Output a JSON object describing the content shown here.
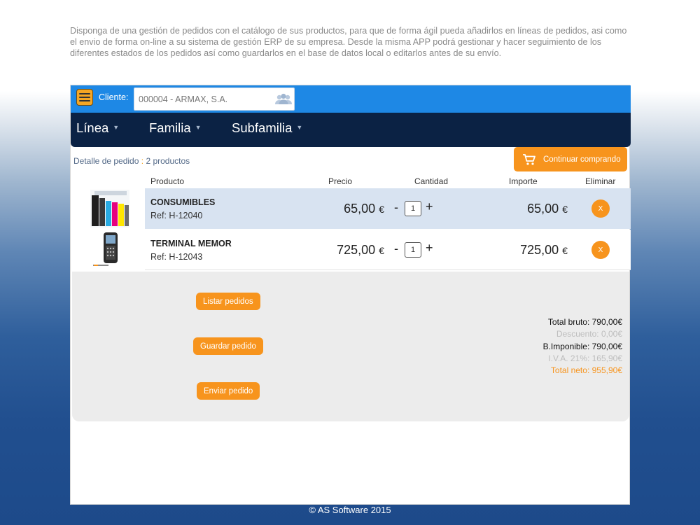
{
  "intro_text": "Disponga de una gestión de pedidos con el catálogo de sus productos, para que de  forma ágil pueda añadirlos en líneas de pedidos, asi como el envio de forma on-line a su sistema de gestión ERP de su empresa. Desde la misma APP podrá gestionar y hacer seguimiento de los diferentes estados de los pedidos así como guardarlos en el base de datos local o editarlos antes de su envío.",
  "topbar": {
    "client_label": "Cliente:",
    "client_value": "000004 - ARMAX, S.A.",
    "icons": {
      "menu": "hamburger-menu-icon",
      "client": "users-icon"
    },
    "colors": {
      "bar": "#1e88e5",
      "menu_button": "#f5a623"
    }
  },
  "categories": [
    {
      "label": "Línea"
    },
    {
      "label": "Familia"
    },
    {
      "label": "Subfamilia"
    }
  ],
  "detail": {
    "label": "Detalle de pedido",
    "separator": ":",
    "count": "2 productos"
  },
  "continue_button": {
    "label": "Continuar comprando",
    "icon": "shopping-cart-icon"
  },
  "table": {
    "headers": {
      "product": "Producto",
      "price": "Precio",
      "quantity": "Cantidad",
      "amount": "Importe",
      "remove": "Eliminar"
    },
    "rows": [
      {
        "name": "CONSUMIBLES",
        "ref": "Ref: H-12040",
        "price": "65,00",
        "currency": "€",
        "qty": "1",
        "amount": "65,00",
        "minus": "-",
        "plus": "+",
        "remove": "X"
      },
      {
        "name": "TERMINAL MEMOR",
        "ref": "Ref: H-12043",
        "price": "725,00",
        "currency": "€",
        "qty": "1",
        "amount": "725,00",
        "minus": "-",
        "plus": "+",
        "remove": "X"
      }
    ]
  },
  "actions": {
    "list": "Listar pedidos",
    "save": "Guardar pedido",
    "send": "Enviar pedido"
  },
  "totals": {
    "gross": "Total bruto: 790,00€",
    "discount": "Descuento: 0,00€",
    "taxable": "B.Imponible: 790,00€",
    "vat": "I.V.A. 21%: 165,90€",
    "net": "Total neto: 955,90€"
  },
  "footer": "© AS Software 2015",
  "colors": {
    "accent": "#f7941d",
    "navy": "#0b2244",
    "selected_row": "#d8e3f1"
  }
}
